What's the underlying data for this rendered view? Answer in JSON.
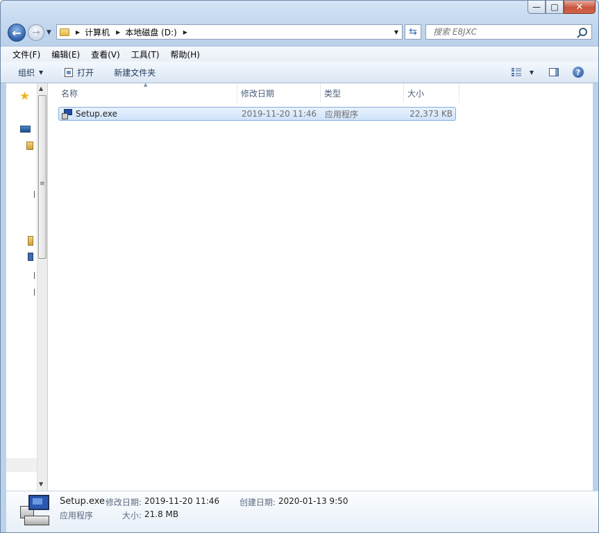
{
  "window": {
    "minimize_glyph": "—",
    "maximize_glyph": "□",
    "close_glyph": "✕"
  },
  "address": {
    "crumbs": [
      "计算机",
      "本地磁盘 (D:)"
    ],
    "search_placeholder": "搜索 E8JXC"
  },
  "menu": {
    "items": [
      "文件(F)",
      "编辑(E)",
      "查看(V)",
      "工具(T)",
      "帮助(H)"
    ]
  },
  "toolbar": {
    "organize_label": "组织",
    "open_label": "打开",
    "new_folder_label": "新建文件夹"
  },
  "columns": {
    "name": "名称",
    "modified": "修改日期",
    "type": "类型",
    "size": "大小"
  },
  "files": [
    {
      "name": "Setup.exe",
      "modified": "2019-11-20 11:46",
      "type": "应用程序",
      "size": "22,373 KB",
      "icon": "exe-setup-icon"
    }
  ],
  "details": {
    "name": "Setup.exe",
    "modified_label": "修改日期:",
    "modified_value": "2019-11-20 11:46",
    "created_label": "创建日期:",
    "created_value": "2020-01-13 9:50",
    "type": "应用程序",
    "size_label": "大小:",
    "size_value": "21.8 MB"
  },
  "colors": {
    "selection_fill": "#cfe3fb",
    "selection_border": "#84acdd",
    "chrome": "#bcd2eb"
  }
}
